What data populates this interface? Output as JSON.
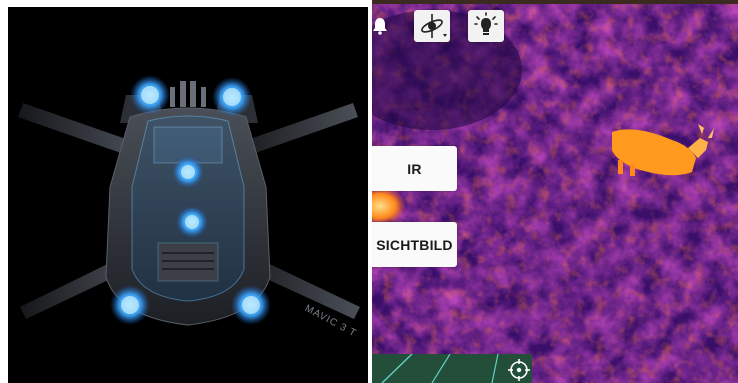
{
  "camera": {
    "ir_label": "IR",
    "visual_label": "SICHTBILD"
  },
  "drone": {
    "model_label": "MAVIC 3 T"
  },
  "icons": {
    "notifications": "bell-icon",
    "gimbal": "gimbal-icon",
    "spotlight": "spotlight-icon",
    "target": "crosshair-icon"
  },
  "colors": {
    "thermal_hot": "#ff9a1f",
    "thermal_cold": "#2a0a5c",
    "drone_glow": "#4fb8ff"
  }
}
